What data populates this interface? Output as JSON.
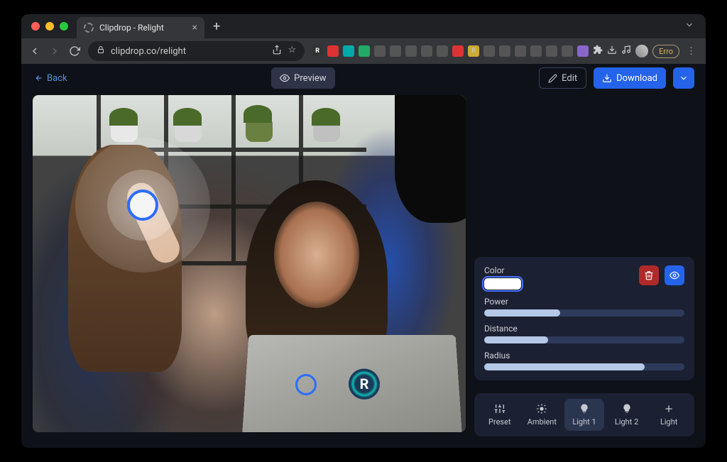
{
  "browser": {
    "tab_title": "Clipdrop - Relight",
    "url": "clipdrop.co/relight",
    "error_badge": "Erro"
  },
  "header": {
    "back_label": "Back",
    "preview_label": "Preview",
    "edit_label": "Edit",
    "download_label": "Download"
  },
  "panel": {
    "color_label": "Color",
    "color_value": "#ffffff",
    "power": {
      "label": "Power",
      "value": 38
    },
    "distance": {
      "label": "Distance",
      "value": 32
    },
    "radius": {
      "label": "Radius",
      "value": 80
    }
  },
  "tabs": {
    "items": [
      {
        "label": "Preset",
        "icon": "sliders-icon"
      },
      {
        "label": "Ambient",
        "icon": "sun-icon"
      },
      {
        "label": "Light 1",
        "icon": "bulb-icon",
        "active": true
      },
      {
        "label": "Light 2",
        "icon": "bulb-icon"
      },
      {
        "label": "Light",
        "icon": "plus-icon"
      }
    ]
  },
  "laptop_sticker_letter": "R"
}
